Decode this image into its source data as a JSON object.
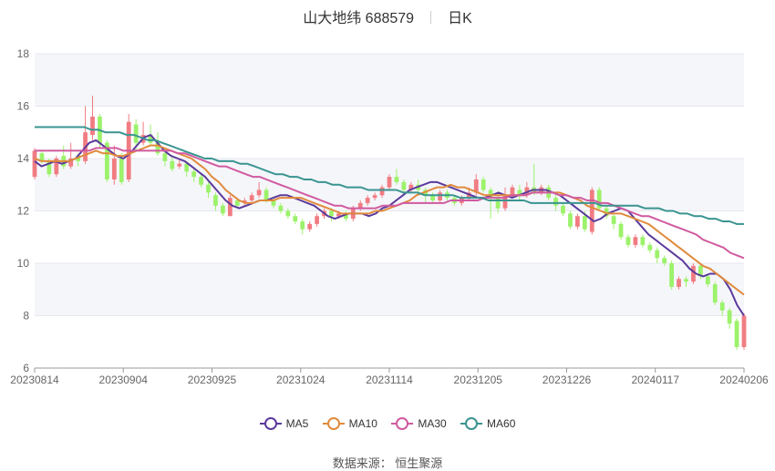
{
  "title": {
    "name": "山大地纬 688579",
    "period": "日K"
  },
  "legend": [
    {
      "key": "ma5",
      "label": "MA5",
      "color": "#5b3a9c"
    },
    {
      "key": "ma10",
      "label": "MA10",
      "color": "#e08a3c"
    },
    {
      "key": "ma30",
      "label": "MA30",
      "color": "#d05aa0"
    },
    {
      "key": "ma60",
      "label": "MA60",
      "color": "#3a9490"
    }
  ],
  "source": "数据来源： 恒生聚源",
  "colors": {
    "up": "#f07c82",
    "down": "#9cf26a",
    "band": "#f5f6fa"
  },
  "chart_data": {
    "type": "candlestick",
    "ylim": [
      6,
      18
    ],
    "yticks": [
      6,
      8,
      10,
      12,
      14,
      16,
      18
    ],
    "xticks": [
      "20230814",
      "20230904",
      "20230925",
      "20231024",
      "20231114",
      "20231205",
      "20231226",
      "20240117",
      "20240206"
    ],
    "grid": true,
    "legend_position": "bottom",
    "series": [
      {
        "name": "MA5",
        "values": [
          13.9,
          13.7,
          13.8,
          13.9,
          13.8,
          13.9,
          14.0,
          14.3,
          14.6,
          14.7,
          14.5,
          14.3,
          14.1,
          14.0,
          14.2,
          14.5,
          14.8,
          14.9,
          14.6,
          14.3,
          14.1,
          14.0,
          13.9,
          13.7,
          13.5,
          13.3,
          13.0,
          12.7,
          12.4,
          12.2,
          12.1,
          12.2,
          12.3,
          12.4,
          12.4,
          12.5,
          12.6,
          12.6,
          12.5,
          12.4,
          12.3,
          12.2,
          12.0,
          11.8,
          11.7,
          11.8,
          11.9,
          11.9,
          11.9,
          11.8,
          11.9,
          12.1,
          12.2,
          12.4,
          12.6,
          12.8,
          12.9,
          13.0,
          13.1,
          13.1,
          13.0,
          12.9,
          12.8,
          12.7,
          12.6,
          12.5,
          12.5,
          12.6,
          12.7,
          12.6,
          12.5,
          12.6,
          12.7,
          12.8,
          12.8,
          12.8,
          12.7,
          12.6,
          12.4,
          12.2,
          12.0,
          11.8,
          11.6,
          11.7,
          11.9,
          12.0,
          12.1,
          12.0,
          11.7,
          11.4,
          11.1,
          10.9,
          10.7,
          10.5,
          10.3,
          10.1,
          9.8,
          9.6,
          9.5,
          9.6,
          9.6,
          9.4,
          9.0,
          8.4,
          8.0
        ]
      },
      {
        "name": "MA10",
        "values": [
          14.0,
          13.9,
          13.9,
          13.9,
          13.9,
          13.9,
          14.0,
          14.1,
          14.2,
          14.3,
          14.2,
          14.2,
          14.1,
          14.1,
          14.2,
          14.3,
          14.4,
          14.5,
          14.5,
          14.4,
          14.3,
          14.2,
          14.1,
          14.0,
          13.8,
          13.6,
          13.3,
          13.1,
          12.8,
          12.6,
          12.4,
          12.3,
          12.3,
          12.4,
          12.4,
          12.4,
          12.5,
          12.5,
          12.5,
          12.5,
          12.4,
          12.3,
          12.2,
          12.1,
          12.0,
          11.9,
          11.9,
          11.9,
          11.9,
          11.9,
          12.0,
          12.0,
          12.1,
          12.2,
          12.3,
          12.4,
          12.6,
          12.7,
          12.8,
          12.9,
          12.9,
          13.0,
          12.9,
          12.9,
          12.8,
          12.7,
          12.6,
          12.6,
          12.6,
          12.6,
          12.6,
          12.6,
          12.6,
          12.7,
          12.7,
          12.7,
          12.7,
          12.7,
          12.6,
          12.5,
          12.4,
          12.2,
          12.1,
          12.0,
          11.9,
          11.9,
          11.9,
          11.8,
          11.7,
          11.6,
          11.5,
          11.3,
          11.1,
          10.9,
          10.7,
          10.5,
          10.3,
          10.1,
          9.9,
          9.8,
          9.6,
          9.4,
          9.2,
          9.0,
          8.8
        ]
      },
      {
        "name": "MA30",
        "values": [
          14.3,
          14.3,
          14.3,
          14.3,
          14.3,
          14.3,
          14.3,
          14.3,
          14.3,
          14.4,
          14.4,
          14.4,
          14.4,
          14.3,
          14.3,
          14.3,
          14.3,
          14.3,
          14.3,
          14.3,
          14.3,
          14.2,
          14.2,
          14.1,
          14.0,
          13.9,
          13.8,
          13.7,
          13.7,
          13.6,
          13.5,
          13.4,
          13.3,
          13.3,
          13.2,
          13.1,
          13.0,
          12.9,
          12.8,
          12.7,
          12.6,
          12.5,
          12.4,
          12.3,
          12.2,
          12.2,
          12.1,
          12.1,
          12.1,
          12.1,
          12.1,
          12.2,
          12.2,
          12.2,
          12.3,
          12.3,
          12.3,
          12.3,
          12.3,
          12.3,
          12.3,
          12.4,
          12.4,
          12.4,
          12.4,
          12.4,
          12.5,
          12.5,
          12.5,
          12.5,
          12.6,
          12.6,
          12.6,
          12.7,
          12.7,
          12.7,
          12.7,
          12.6,
          12.6,
          12.5,
          12.5,
          12.4,
          12.4,
          12.3,
          12.3,
          12.2,
          12.1,
          12.0,
          11.9,
          11.8,
          11.8,
          11.7,
          11.6,
          11.5,
          11.4,
          11.3,
          11.2,
          11.1,
          10.9,
          10.8,
          10.7,
          10.6,
          10.4,
          10.3,
          10.2
        ]
      },
      {
        "name": "MA60",
        "values": [
          15.2,
          15.2,
          15.2,
          15.2,
          15.2,
          15.2,
          15.2,
          15.2,
          15.1,
          15.1,
          15.0,
          15.0,
          15.0,
          14.9,
          14.9,
          14.8,
          14.7,
          14.7,
          14.6,
          14.5,
          14.4,
          14.3,
          14.2,
          14.1,
          14.0,
          14.0,
          13.9,
          13.9,
          13.9,
          13.8,
          13.8,
          13.7,
          13.6,
          13.5,
          13.4,
          13.4,
          13.3,
          13.3,
          13.2,
          13.2,
          13.1,
          13.1,
          13.0,
          13.0,
          12.9,
          12.9,
          12.9,
          12.8,
          12.8,
          12.8,
          12.8,
          12.8,
          12.7,
          12.7,
          12.7,
          12.6,
          12.6,
          12.6,
          12.6,
          12.6,
          12.5,
          12.5,
          12.5,
          12.5,
          12.4,
          12.4,
          12.4,
          12.4,
          12.4,
          12.4,
          12.3,
          12.3,
          12.3,
          12.3,
          12.3,
          12.3,
          12.3,
          12.3,
          12.3,
          12.3,
          12.2,
          12.2,
          12.2,
          12.2,
          12.2,
          12.2,
          12.1,
          12.1,
          12.1,
          12.0,
          12.0,
          11.9,
          11.9,
          11.8,
          11.8,
          11.7,
          11.7,
          11.6,
          11.6,
          11.5,
          11.5
        ]
      }
    ],
    "candles": [
      [
        13.3,
        14.3,
        14.4,
        13.2
      ],
      [
        14.2,
        13.9,
        14.3,
        13.8
      ],
      [
        13.9,
        13.4,
        14.0,
        13.3
      ],
      [
        13.4,
        14.0,
        14.1,
        13.3
      ],
      [
        14.1,
        13.7,
        14.5,
        13.6
      ],
      [
        13.7,
        14.0,
        14.6,
        13.6
      ],
      [
        14.1,
        13.9,
        14.2,
        13.7
      ],
      [
        13.9,
        15.0,
        16.0,
        13.8
      ],
      [
        14.9,
        15.6,
        16.4,
        14.7
      ],
      [
        15.6,
        14.6,
        15.7,
        14.4
      ],
      [
        14.6,
        13.2,
        14.7,
        13.1
      ],
      [
        13.2,
        14.0,
        14.5,
        13.0
      ],
      [
        14.0,
        13.1,
        14.2,
        13.0
      ],
      [
        13.2,
        15.4,
        15.7,
        13.1
      ],
      [
        15.3,
        14.6,
        15.5,
        14.3
      ],
      [
        14.6,
        14.9,
        15.4,
        14.5
      ],
      [
        14.9,
        14.6,
        15.3,
        14.5
      ],
      [
        14.6,
        14.2,
        15.0,
        14.1
      ],
      [
        14.2,
        13.9,
        14.4,
        13.7
      ],
      [
        13.9,
        13.6,
        14.1,
        13.5
      ],
      [
        13.7,
        13.8,
        14.0,
        13.6
      ],
      [
        13.8,
        13.5,
        13.9,
        13.3
      ],
      [
        13.5,
        13.3,
        13.6,
        13.1
      ],
      [
        13.3,
        13.0,
        13.4,
        12.9
      ],
      [
        13.0,
        12.7,
        13.1,
        12.5
      ],
      [
        12.6,
        12.2,
        12.7,
        12.0
      ],
      [
        12.2,
        11.9,
        12.3,
        11.8
      ],
      [
        11.8,
        12.5,
        12.6,
        11.8
      ],
      [
        12.4,
        12.2,
        12.5,
        12.1
      ],
      [
        12.3,
        12.4,
        12.5,
        12.2
      ],
      [
        12.4,
        12.6,
        12.7,
        12.3
      ],
      [
        12.6,
        12.8,
        13.1,
        12.5
      ],
      [
        12.8,
        12.4,
        12.9,
        12.3
      ],
      [
        12.4,
        12.2,
        12.5,
        12.1
      ],
      [
        12.2,
        12.0,
        12.3,
        11.9
      ],
      [
        12.0,
        11.8,
        12.1,
        11.7
      ],
      [
        11.8,
        11.6,
        11.9,
        11.5
      ],
      [
        11.6,
        11.3,
        11.7,
        11.1
      ],
      [
        11.3,
        11.5,
        11.6,
        11.2
      ],
      [
        11.5,
        11.8,
        11.9,
        11.4
      ],
      [
        11.8,
        12.0,
        12.1,
        11.7
      ],
      [
        12.0,
        11.8,
        12.1,
        11.6
      ],
      [
        11.8,
        11.9,
        12.0,
        11.7
      ],
      [
        11.9,
        11.7,
        12.0,
        11.6
      ],
      [
        11.7,
        12.1,
        12.2,
        11.6
      ],
      [
        12.1,
        12.3,
        12.4,
        12.0
      ],
      [
        12.3,
        12.5,
        12.6,
        12.2
      ],
      [
        12.5,
        12.6,
        12.7,
        12.4
      ],
      [
        12.6,
        12.9,
        13.0,
        12.5
      ],
      [
        12.9,
        13.3,
        13.4,
        12.8
      ],
      [
        13.3,
        13.1,
        13.6,
        13.0
      ],
      [
        13.1,
        12.8,
        13.2,
        12.7
      ],
      [
        12.8,
        13.0,
        13.1,
        12.7
      ],
      [
        13.0,
        12.8,
        13.2,
        12.6
      ],
      [
        12.8,
        12.6,
        12.9,
        12.3
      ],
      [
        12.6,
        12.4,
        12.7,
        12.3
      ],
      [
        12.4,
        12.7,
        12.8,
        12.3
      ],
      [
        12.7,
        12.5,
        12.8,
        12.4
      ],
      [
        12.5,
        12.3,
        12.6,
        12.2
      ],
      [
        12.3,
        12.5,
        12.6,
        12.2
      ],
      [
        12.5,
        12.7,
        12.9,
        12.4
      ],
      [
        12.7,
        13.2,
        13.4,
        12.6
      ],
      [
        13.2,
        12.8,
        13.3,
        12.7
      ],
      [
        12.8,
        12.5,
        12.9,
        11.7
      ],
      [
        12.5,
        12.1,
        12.6,
        11.9
      ],
      [
        12.1,
        12.6,
        12.9,
        12.0
      ],
      [
        12.6,
        12.9,
        13.0,
        12.5
      ],
      [
        12.8,
        12.6,
        13.0,
        12.4
      ],
      [
        12.6,
        12.9,
        13.1,
        12.5
      ],
      [
        12.9,
        12.7,
        13.8,
        12.6
      ],
      [
        12.7,
        12.9,
        13.0,
        12.6
      ],
      [
        12.9,
        12.5,
        13.0,
        12.4
      ],
      [
        12.5,
        12.2,
        12.6,
        12.0
      ],
      [
        12.2,
        11.9,
        12.3,
        11.8
      ],
      [
        11.9,
        11.4,
        12.0,
        11.3
      ],
      [
        11.4,
        11.8,
        11.9,
        11.3
      ],
      [
        11.8,
        11.3,
        12.0,
        11.2
      ],
      [
        11.2,
        12.8,
        12.9,
        11.1
      ],
      [
        12.8,
        12.1,
        12.9,
        12.0
      ],
      [
        12.1,
        11.8,
        12.2,
        11.7
      ],
      [
        11.8,
        11.5,
        11.9,
        11.3
      ],
      [
        11.5,
        11.0,
        11.6,
        10.9
      ],
      [
        11.0,
        10.7,
        11.1,
        10.6
      ],
      [
        10.7,
        11.0,
        11.1,
        10.6
      ],
      [
        11.0,
        10.7,
        11.1,
        10.6
      ],
      [
        10.7,
        10.5,
        10.8,
        10.4
      ],
      [
        10.5,
        10.2,
        10.6,
        10.0
      ],
      [
        10.2,
        10.0,
        10.3,
        9.9
      ],
      [
        10.0,
        9.1,
        10.1,
        9.0
      ],
      [
        9.1,
        9.4,
        9.5,
        9.0
      ],
      [
        9.4,
        9.3,
        9.5,
        9.1
      ],
      [
        9.3,
        9.9,
        10.0,
        9.2
      ],
      [
        9.9,
        9.5,
        10.0,
        9.4
      ],
      [
        9.5,
        9.2,
        9.6,
        9.1
      ],
      [
        9.2,
        8.5,
        9.3,
        8.4
      ],
      [
        8.5,
        8.2,
        8.6,
        8.0
      ],
      [
        8.2,
        7.7,
        8.3,
        7.5
      ],
      [
        7.8,
        6.8,
        7.9,
        6.7
      ],
      [
        6.8,
        8.0,
        8.1,
        6.7
      ]
    ]
  }
}
